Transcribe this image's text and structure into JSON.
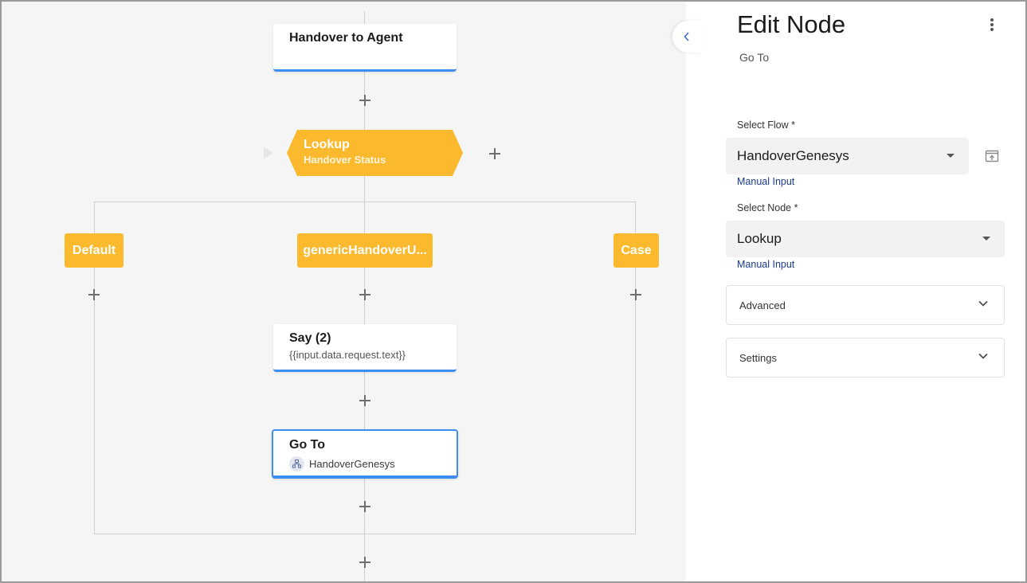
{
  "canvas": {
    "nodes": {
      "handover_agent": {
        "title": "Handover to Agent"
      },
      "lookup": {
        "title": "Lookup",
        "subtitle": "Handover Status"
      },
      "branches": [
        "Default",
        "genericHandoverU...",
        "Case"
      ],
      "say": {
        "title": "Say (2)",
        "subtitle": "{{input.data.request.text}}"
      },
      "goto": {
        "title": "Go To",
        "subtitle": "HandoverGenesys",
        "icon": "flow-icon"
      }
    },
    "colors": {
      "accent_blue": "#3d8ef0",
      "lookup_yellow": "#fbb92d",
      "canvas_bg": "#f5f5f5"
    }
  },
  "panel": {
    "title": "Edit Node",
    "subtitle": "Go To",
    "menu_icon": "kebab-menu-icon",
    "select_flow": {
      "label": "Select Flow *",
      "value": "HandoverGenesys",
      "manual_input": "Manual Input",
      "open_icon": "open-in-new-icon"
    },
    "select_node": {
      "label": "Select Node *",
      "value": "Lookup",
      "manual_input": "Manual Input"
    },
    "sections": [
      "Advanced",
      "Settings"
    ]
  }
}
